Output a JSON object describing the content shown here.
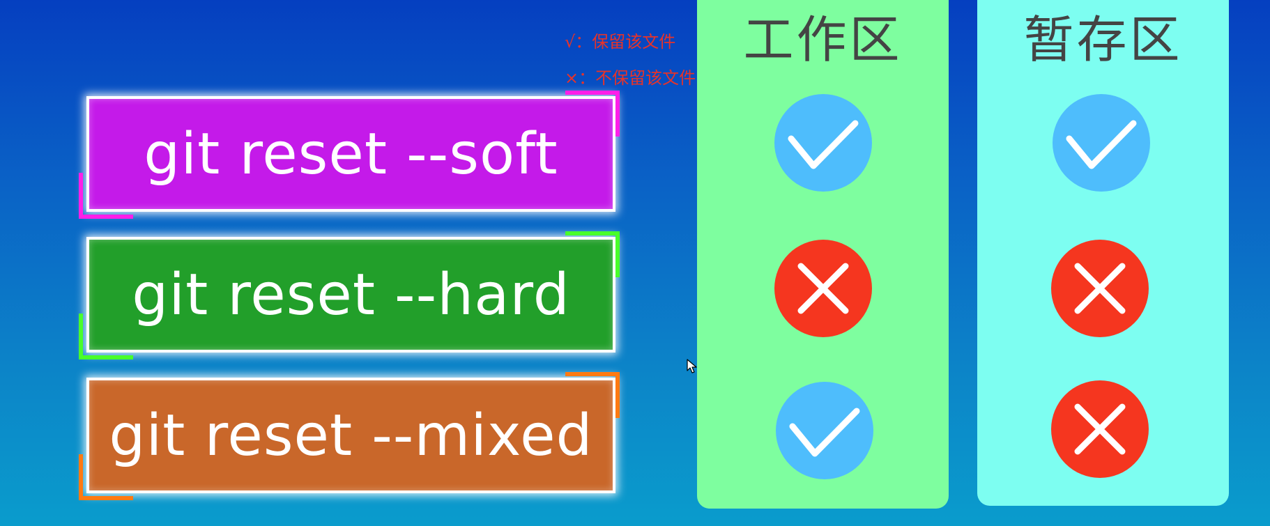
{
  "legend": {
    "keep": "√：保留该文件",
    "discard": "×：不保留该文件"
  },
  "commands": [
    {
      "label": "git reset --soft",
      "color": "#c41ae9",
      "accent": "#ff1fe8"
    },
    {
      "label": "git reset --hard",
      "color": "#229f2a",
      "accent": "#49ff2b"
    },
    {
      "label": "git reset --mixed",
      "color": "#c9672a",
      "accent": "#ff7a12"
    }
  ],
  "columns": [
    {
      "title": "工作区",
      "color": "#7efe9f",
      "marks": [
        "check",
        "cross",
        "check"
      ]
    },
    {
      "title": "暂存区",
      "color": "#7dfef1",
      "marks": [
        "check",
        "cross",
        "cross"
      ]
    }
  ],
  "mark_colors": {
    "check": "#4ebdfc",
    "cross": "#f5361f"
  }
}
